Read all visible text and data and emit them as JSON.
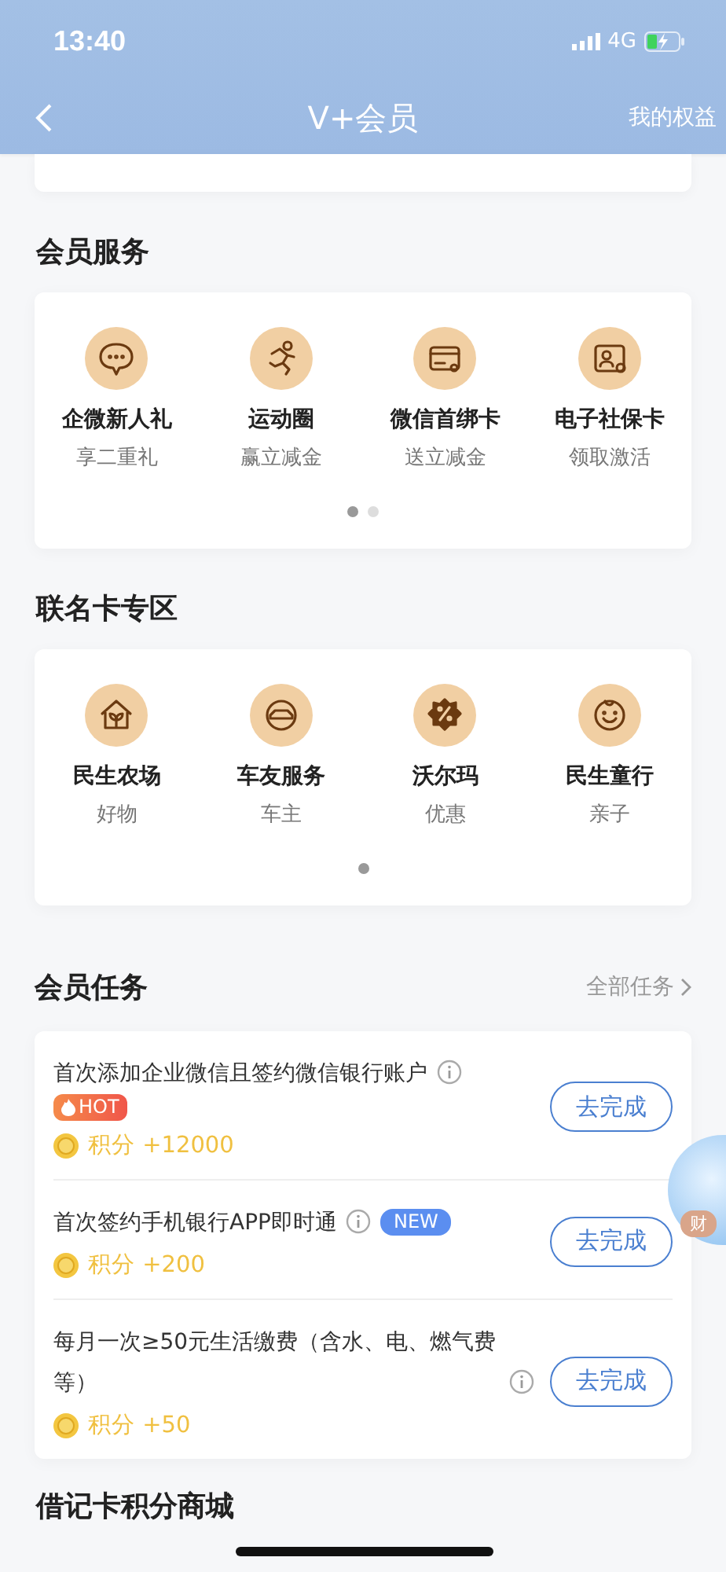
{
  "status_bar": {
    "time": "13:40",
    "network": "4G"
  },
  "nav": {
    "title": "V+会员",
    "right_link": "我的权益"
  },
  "sections": [
    {
      "title": "会员服务",
      "items": [
        {
          "name": "企微新人礼",
          "sub": "享二重礼"
        },
        {
          "name": "运动圈",
          "sub": "赢立减金"
        },
        {
          "name": "微信首绑卡",
          "sub": "送立减金"
        },
        {
          "name": "电子社保卡",
          "sub": "领取激活"
        }
      ],
      "pager": [
        {
          "selected": true
        },
        {
          "selected": false
        }
      ]
    },
    {
      "title": "联名卡专区",
      "items": [
        {
          "name": "民生农场",
          "sub": "好物"
        },
        {
          "name": "车友服务",
          "sub": "车主"
        },
        {
          "name": "沃尔玛",
          "sub": "优惠"
        },
        {
          "name": "民生童行",
          "sub": "亲子"
        }
      ],
      "pager": [
        {
          "selected": true
        }
      ]
    }
  ],
  "tasks": {
    "title": "会员任务",
    "more": "全部任务",
    "items": [
      {
        "title": "首次添加企业微信且签约微信银行账户",
        "badge": {
          "kind": "hot",
          "text": "HOT"
        },
        "points": "积分 +12000",
        "button": "去完成"
      },
      {
        "title": "首次签约手机银行APP即时通",
        "badge": {
          "kind": "new",
          "text": "NEW"
        },
        "points": "积分 +200",
        "button": "去完成"
      },
      {
        "title": "每月一次≥50元生活缴费（含水、电、燃气费等）",
        "points": "积分 +50",
        "button": "去完成"
      }
    ]
  },
  "mascot": {
    "tag": "财"
  },
  "next_section": {
    "title": "借记卡积分商城"
  }
}
